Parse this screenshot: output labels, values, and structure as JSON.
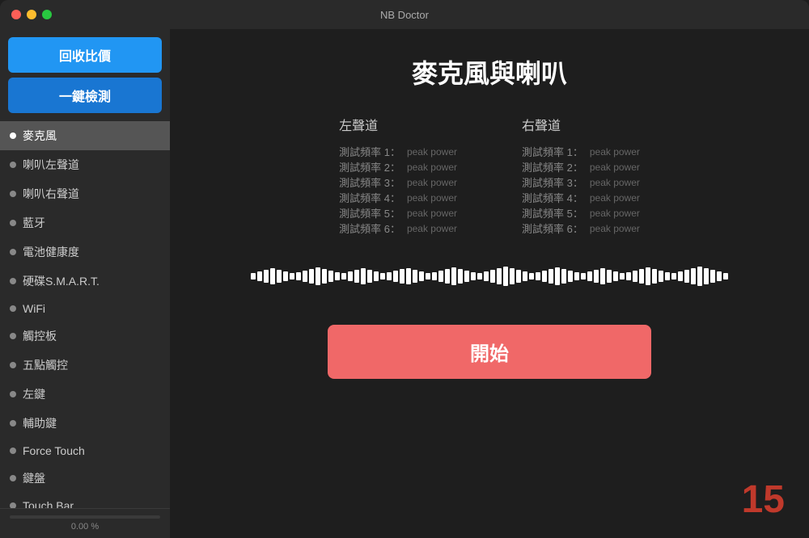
{
  "window": {
    "title": "NB Doctor"
  },
  "sidebar": {
    "btn_recycle": "回收比價",
    "btn_scan": "一鍵檢測",
    "items": [
      {
        "label": "麥克風",
        "active": true
      },
      {
        "label": "喇叭左聲道",
        "active": false
      },
      {
        "label": "喇叭右聲道",
        "active": false
      },
      {
        "label": "藍牙",
        "active": false
      },
      {
        "label": "電池健康度",
        "active": false
      },
      {
        "label": "硬碟S.M.A.R.T.",
        "active": false
      },
      {
        "label": "WiFi",
        "active": false
      },
      {
        "label": "觸控板",
        "active": false
      },
      {
        "label": "五點觸控",
        "active": false
      },
      {
        "label": "左鍵",
        "active": false
      },
      {
        "label": "輔助鍵",
        "active": false
      },
      {
        "label": "Force Touch",
        "active": false
      },
      {
        "label": "鍵盤",
        "active": false
      },
      {
        "label": "Touch Bar",
        "active": false
      }
    ],
    "progress_text": "0.00 %",
    "progress_value": 0
  },
  "content": {
    "title": "麥克風與喇叭",
    "left_channel": {
      "label": "左聲道",
      "rows": [
        {
          "freq_label": "測試頻率 1：",
          "value": "peak power"
        },
        {
          "freq_label": "測試頻率 2：",
          "value": "peak power"
        },
        {
          "freq_label": "測試頻率 3：",
          "value": "peak power"
        },
        {
          "freq_label": "測試頻率 4：",
          "value": "peak power"
        },
        {
          "freq_label": "測試頻率 5：",
          "value": "peak power"
        },
        {
          "freq_label": "測試頻率 6：",
          "value": "peak power"
        }
      ]
    },
    "right_channel": {
      "label": "右聲道",
      "rows": [
        {
          "freq_label": "測試頻率 1：",
          "value": "peak power"
        },
        {
          "freq_label": "測試頻率 2：",
          "value": "peak power"
        },
        {
          "freq_label": "測試頻率 3：",
          "value": "peak power"
        },
        {
          "freq_label": "測試頻率 4：",
          "value": "peak power"
        },
        {
          "freq_label": "測試頻率 5：",
          "value": "peak power"
        },
        {
          "freq_label": "測試頻率 6：",
          "value": "peak power"
        }
      ]
    },
    "start_button_label": "開始",
    "number_badge": "15"
  },
  "colors": {
    "accent": "#2196F3",
    "start_button": "#f06868",
    "badge": "#c0392b"
  }
}
